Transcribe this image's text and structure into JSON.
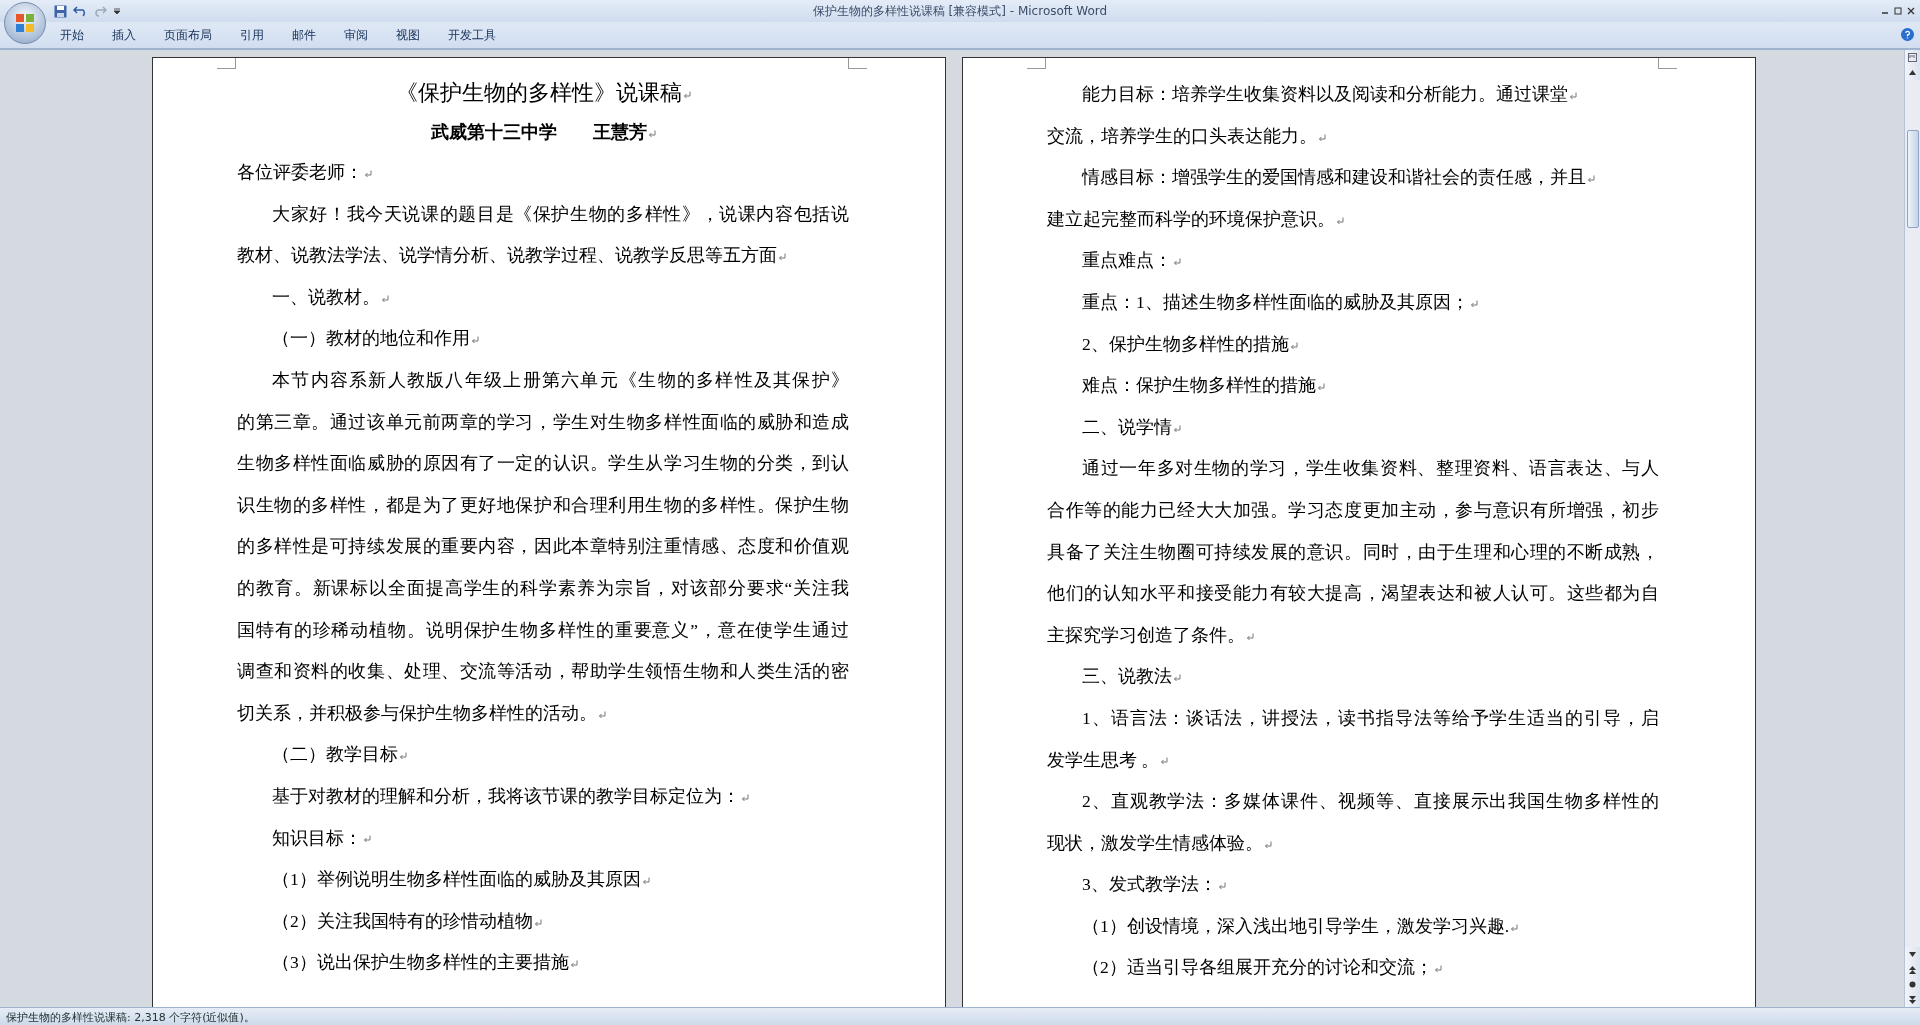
{
  "window": {
    "title": "保护生物的多样性说课稿 [兼容模式] - Microsoft Word"
  },
  "ribbon_tabs": [
    {
      "label": "开始"
    },
    {
      "label": "插入"
    },
    {
      "label": "页面布局"
    },
    {
      "label": "引用"
    },
    {
      "label": "邮件"
    },
    {
      "label": "审阅"
    },
    {
      "label": "视图"
    },
    {
      "label": "开发工具"
    }
  ],
  "pages": [
    {
      "paragraphs": [
        {
          "kind": "title",
          "lines": [
            "《保护生物的多样性》说课稿"
          ]
        },
        {
          "kind": "byline",
          "lines": [
            "武威第十三中学　　王慧芳"
          ]
        },
        {
          "kind": "flush",
          "lines": [
            "各位评委老师："
          ]
        },
        {
          "kind": "indented",
          "lines": [
            "大家好！我今天说课的题目是《保护生物的多样性》，说课内容包括说",
            "教材、说教法学法、说学情分析、说教学过程、说教学反思等五方面"
          ]
        },
        {
          "kind": "indented",
          "lines": [
            "一、说教材。"
          ]
        },
        {
          "kind": "indented",
          "lines": [
            "（一）教材的地位和作用"
          ]
        },
        {
          "kind": "indented",
          "lines": [
            "本节内容系新人教版八年级上册第六单元《生物的多样性及其保护》",
            "的第三章。通过该单元前两章的学习，学生对生物多样性面临的威胁和造成",
            "生物多样性面临威胁的原因有了一定的认识。学生从学习生物的分类，到认",
            "识生物的多样性，都是为了更好地保护和合理利用生物的多样性。保护生物",
            "的多样性是可持续发展的重要内容，因此本章特别注重情感、态度和价值观",
            "的教育。新课标以全面提高学生的科学素养为宗旨，对该部分要求“关注我",
            "国特有的珍稀动植物。说明保护生物多样性的重要意义”，意在使学生通过",
            "调查和资料的收集、处理、交流等活动，帮助学生领悟生物和人类生活的密",
            "切关系，并积极参与保护生物多样性的活动。"
          ]
        },
        {
          "kind": "indented",
          "lines": [
            "（二）教学目标"
          ]
        },
        {
          "kind": "indented",
          "lines": [
            "基于对教材的理解和分析，我将该节课的教学目标定位为："
          ]
        },
        {
          "kind": "indented",
          "lines": [
            "知识目标："
          ]
        },
        {
          "kind": "indented",
          "lines": [
            "（1）举例说明生物多样性面临的威胁及其原因"
          ]
        },
        {
          "kind": "indented",
          "lines": [
            "（2）关注我国特有的珍惜动植物"
          ]
        },
        {
          "kind": "indented",
          "lines": [
            "（3）说出保护生物多样性的主要措施"
          ]
        }
      ]
    },
    {
      "paragraphs": [
        {
          "kind": "indented",
          "lines": [
            "能力目标：培养学生收集资料以及阅读和分析能力。通过课堂"
          ]
        },
        {
          "kind": "flush",
          "lines": [
            "交流，培养学生的口头表达能力。"
          ]
        },
        {
          "kind": "indented",
          "lines": [
            "情感目标：增强学生的爱国情感和建设和谐社会的责任感，并且"
          ]
        },
        {
          "kind": "flush",
          "lines": [
            "建立起完整而科学的环境保护意识。"
          ]
        },
        {
          "kind": "indented",
          "lines": [
            "重点难点："
          ]
        },
        {
          "kind": "indented",
          "lines": [
            "重点：1、描述生物多样性面临的威胁及其原因；"
          ]
        },
        {
          "kind": "indented",
          "lines": [
            "2、保护生物多样性的措施"
          ]
        },
        {
          "kind": "indented",
          "lines": [
            "难点：保护生物多样性的措施"
          ]
        },
        {
          "kind": "indented",
          "lines": [
            "二、说学情"
          ]
        },
        {
          "kind": "indented",
          "lines": [
            "通过一年多对生物的学习，学生收集资料、整理资料、语言表达、与人",
            "合作等的能力已经大大加强。学习态度更加主动，参与意识有所增强，初步",
            "具备了关注生物圈可持续发展的意识。同时，由于生理和心理的不断成熟，",
            "他们的认知水平和接受能力有较大提高，渴望表达和被人认可。这些都为自",
            "主探究学习创造了条件。"
          ]
        },
        {
          "kind": "indented",
          "lines": [
            "三、说教法"
          ]
        },
        {
          "kind": "indented",
          "lines": [
            "1、语言法：谈话法，讲授法，读书指导法等给予学生适当的引导，启",
            "发学生思考 。"
          ]
        },
        {
          "kind": "indented",
          "lines": [
            "2、直观教学法：多媒体课件、视频等、直接展示出我国生物多样性的",
            "现状，激发学生情感体验。"
          ]
        },
        {
          "kind": "indented",
          "lines": [
            "3、发式教学法："
          ]
        },
        {
          "kind": "indented",
          "lines": [
            "（1）创设情境，深入浅出地引导学生，激发学习兴趣."
          ]
        },
        {
          "kind": "indented",
          "lines": [
            "（2）适当引导各组展开充分的讨论和交流；"
          ]
        }
      ]
    }
  ],
  "status_bar": {
    "text": "保护生物的多样性说课稿: 2,318 个字符(近似值)。"
  }
}
